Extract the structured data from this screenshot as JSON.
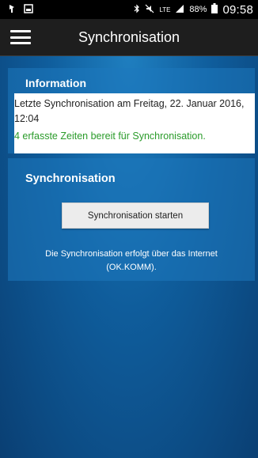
{
  "statusbar": {
    "battery": "88%",
    "network": "LTE",
    "clock": "09:58"
  },
  "toolbar": {
    "title": "Synchronisation"
  },
  "info_panel": {
    "heading": "Information",
    "last_sync": "Letzte Synchronisation am Freitag, 22. Januar 2016, 12:04",
    "ready": "4 erfasste Zeiten bereit für Synchronisation."
  },
  "sync_panel": {
    "heading": "Synchronisation",
    "button_label": "Synchronisation starten",
    "note": "Die Synchronisation erfolgt über das Internet (OK.KOMM)."
  }
}
